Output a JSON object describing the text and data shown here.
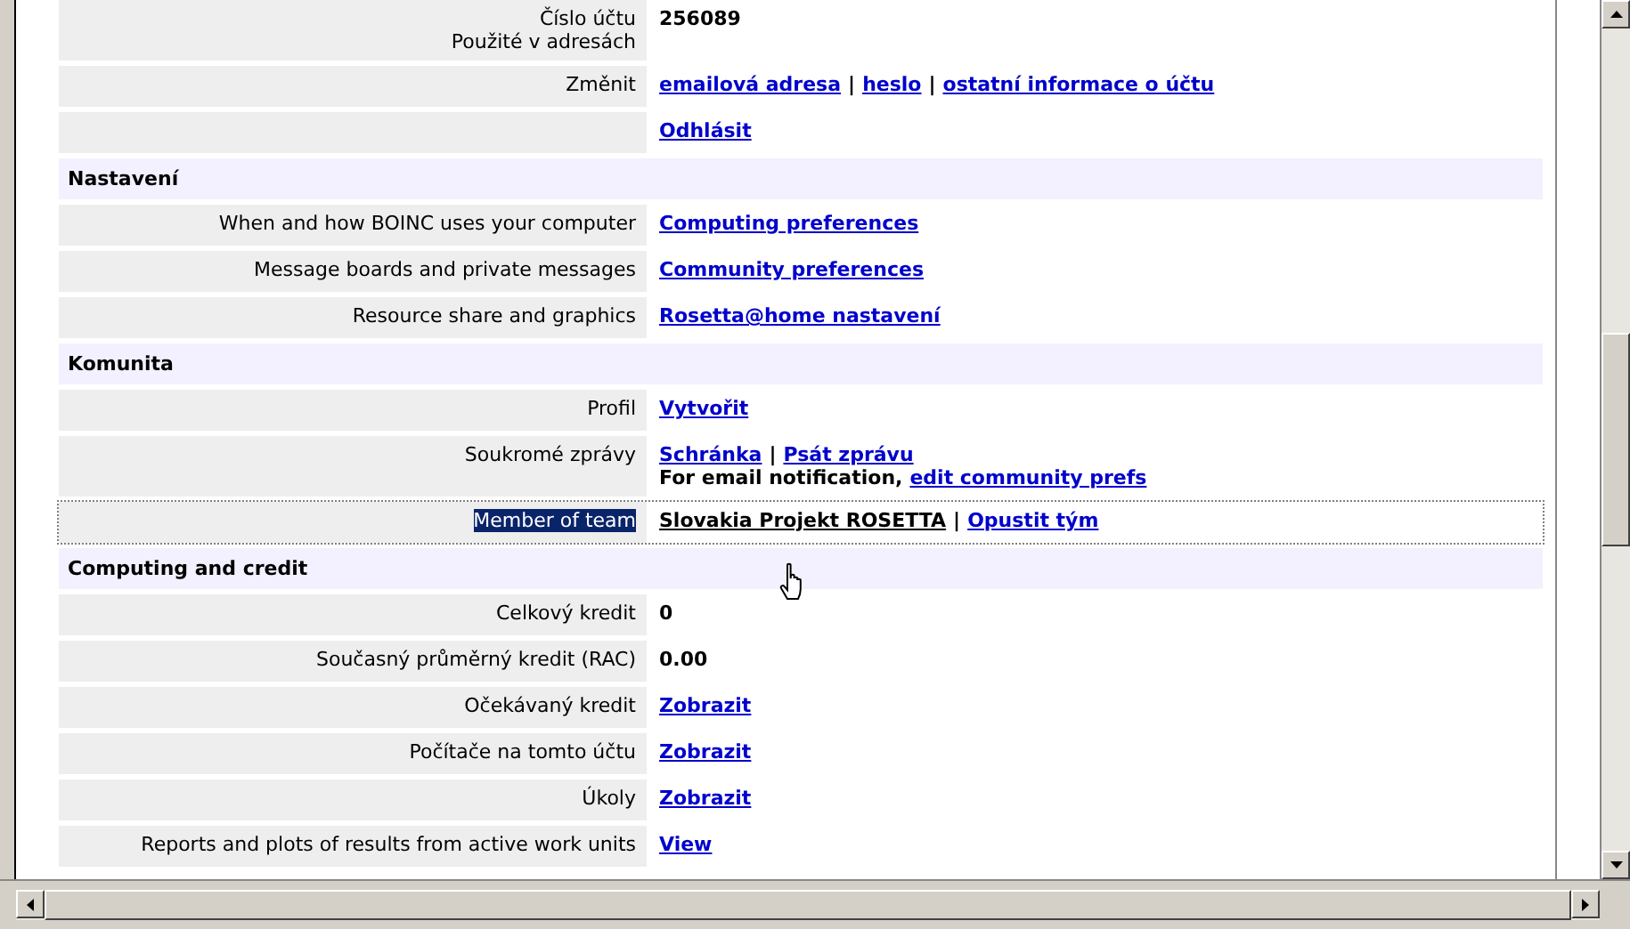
{
  "sections": [
    {
      "rows": [
        {
          "label": [
            "Číslo účtu",
            "Použité v adresách"
          ],
          "selected": false,
          "lines": [
            [
              {
                "kind": "text",
                "text": "256089"
              }
            ]
          ]
        },
        {
          "label": [
            "Změnit"
          ],
          "selected": false,
          "lines": [
            [
              {
                "kind": "link",
                "text": "emailová adresa"
              },
              {
                "kind": "sep",
                "text": "|"
              },
              {
                "kind": "link",
                "text": "heslo"
              },
              {
                "kind": "sep",
                "text": "|"
              },
              {
                "kind": "link",
                "text": "ostatní informace o účtu"
              }
            ]
          ]
        },
        {
          "label": [],
          "selected": false,
          "lines": [
            [
              {
                "kind": "link",
                "text": "Odhlásit"
              }
            ]
          ]
        }
      ]
    },
    {
      "title": "Nastavení",
      "rows": [
        {
          "label": [
            "When and how BOINC uses your computer"
          ],
          "selected": false,
          "lines": [
            [
              {
                "kind": "link",
                "text": "Computing preferences"
              }
            ]
          ]
        },
        {
          "label": [
            "Message boards and private messages"
          ],
          "selected": false,
          "lines": [
            [
              {
                "kind": "link",
                "text": "Community preferences"
              }
            ]
          ]
        },
        {
          "label": [
            "Resource share and graphics"
          ],
          "selected": false,
          "lines": [
            [
              {
                "kind": "link",
                "text": "Rosetta@home nastavení"
              }
            ]
          ]
        }
      ]
    },
    {
      "title": "Komunita",
      "rows": [
        {
          "label": [
            "Profil"
          ],
          "selected": false,
          "lines": [
            [
              {
                "kind": "link",
                "text": "Vytvořit"
              }
            ]
          ]
        },
        {
          "label": [
            "Soukromé zprávy"
          ],
          "selected": false,
          "lines": [
            [
              {
                "kind": "link",
                "text": "Schránka"
              },
              {
                "kind": "sep",
                "text": "|"
              },
              {
                "kind": "link",
                "text": "Psát zprávu"
              }
            ],
            [
              {
                "kind": "text",
                "text": "For email notification,"
              },
              {
                "kind": "link",
                "text": "edit community prefs"
              }
            ]
          ]
        },
        {
          "label": [
            "Member of team"
          ],
          "selected": true,
          "lines": [
            [
              {
                "kind": "visited",
                "text": "Slovakia Projekt ROSETTA"
              },
              {
                "kind": "sep",
                "text": "|"
              },
              {
                "kind": "link",
                "text": "Opustit tým"
              }
            ]
          ]
        }
      ]
    },
    {
      "title": "Computing and credit",
      "rows": [
        {
          "label": [
            "Celkový kredit"
          ],
          "selected": false,
          "lines": [
            [
              {
                "kind": "text",
                "text": "0"
              }
            ]
          ]
        },
        {
          "label": [
            "Současný průměrný kredit (RAC)"
          ],
          "selected": false,
          "lines": [
            [
              {
                "kind": "text",
                "text": "0.00"
              }
            ]
          ]
        },
        {
          "label": [
            "Očekávaný kredit"
          ],
          "selected": false,
          "lines": [
            [
              {
                "kind": "link",
                "text": "Zobrazit"
              }
            ]
          ]
        },
        {
          "label": [
            "Počítače na tomto účtu"
          ],
          "selected": false,
          "lines": [
            [
              {
                "kind": "link",
                "text": "Zobrazit"
              }
            ]
          ]
        },
        {
          "label": [
            "Úkoly"
          ],
          "selected": false,
          "lines": [
            [
              {
                "kind": "link",
                "text": "Zobrazit"
              }
            ]
          ]
        },
        {
          "label": [
            "Reports and plots of results from active work units"
          ],
          "selected": false,
          "lines": [
            [
              {
                "kind": "link",
                "text": "View"
              }
            ]
          ]
        }
      ]
    }
  ]
}
